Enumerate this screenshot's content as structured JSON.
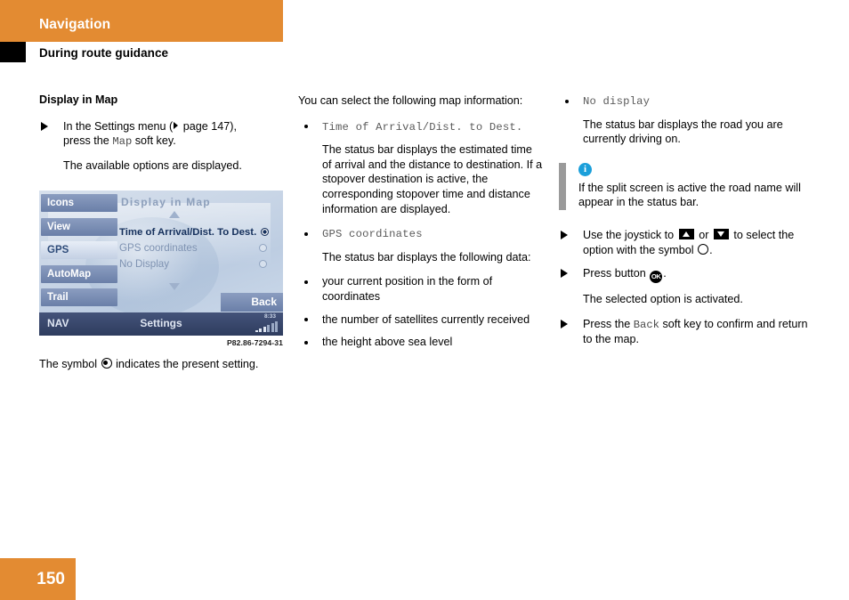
{
  "header": {
    "chapter": "Navigation",
    "section": "During route guidance"
  },
  "column1": {
    "section_title": "Display in Map",
    "step1_pre": "In the Settings menu (",
    "step1_pageref": " page 147),",
    "step1_line2_pre": "press the ",
    "step1_softkey": "Map",
    "step1_line2_post": " soft key.",
    "step1_result": "The available options are displayed.",
    "figure": {
      "screen_title": "Display in Map",
      "softkeys": [
        {
          "label": "Icons",
          "active": false
        },
        {
          "label": "View",
          "active": false
        },
        {
          "label": "GPS",
          "active": true
        },
        {
          "label": "AutoMap",
          "active": false
        },
        {
          "label": "Trail",
          "active": false
        }
      ],
      "back_key": "Back",
      "options": [
        {
          "label": "Time of Arrival/Dist. To Dest.",
          "selected": true
        },
        {
          "label": "GPS coordinates",
          "selected": false
        },
        {
          "label": "No Display",
          "selected": false
        }
      ],
      "status_left": "NAV",
      "status_center": "Settings",
      "status_clock": "8:33",
      "figure_id": "P82.86-7294-31"
    },
    "caption_pre": "The symbol ",
    "caption_post": " indicates the present setting."
  },
  "column2": {
    "intro": "You can select the following map information:",
    "item1_mono": "Time of Arrival/Dist. to Dest.",
    "item1_text": "The status bar displays the estimated time of arrival and the distance to destination. If a stopover destination is active, the corresponding stopover time and distance information are displayed.",
    "item2_mono": "GPS coordinates",
    "item2_text": "The status bar displays the following data:",
    "subitems": [
      "your current position in the form of coordinates",
      "the number of satellites currently received",
      "the height above sea level"
    ]
  },
  "column3": {
    "item3_mono": "No display",
    "item3_text": "The status bar displays the road you are currently driving on.",
    "note_icon": "i",
    "note_text": "If the split screen is active the road name will appear in the status bar.",
    "step2_pre": "Use the joystick to ",
    "step2_mid": " or ",
    "step2_post": " to select the option with the symbol ",
    "step2_end": ".",
    "step3_pre": "Press button ",
    "step3_ok": "OK",
    "step3_post": ".",
    "step3_result": "The selected option is activated.",
    "step4_pre": "Press the ",
    "step4_mono": "Back",
    "step4_post": " soft key to confirm and return to the map."
  },
  "footer": {
    "page_number": "150"
  },
  "colors": {
    "brand_orange": "#e38b32",
    "note_blue": "#1b9fda",
    "note_bar_grey": "#9a9a9a",
    "mono_grey": "#5a5a5a"
  }
}
